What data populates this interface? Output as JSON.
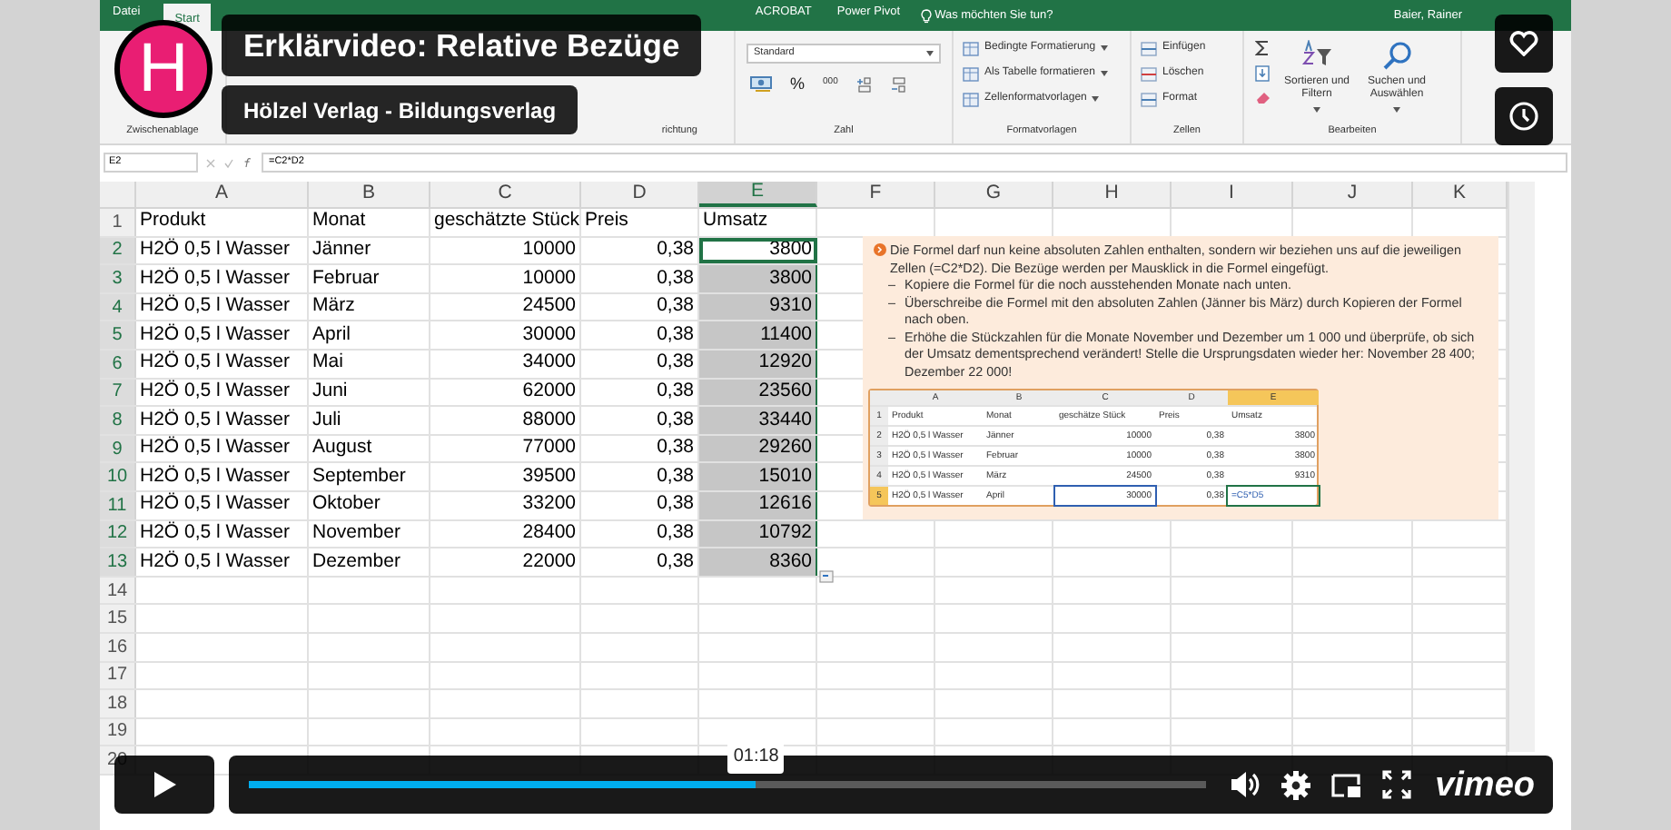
{
  "video": {
    "logo_letter": "H",
    "title": "Erklärvideo: Relative Bezüge",
    "channel": "Hölzel Verlag - Bildungsverlag",
    "progress": {
      "level": 0.53,
      "tooltip": "01:18"
    },
    "brand": "vimeo"
  },
  "excel": {
    "ribbon_tabs": [
      {
        "label": "Datei",
        "selected": false
      },
      {
        "label": "Start",
        "selected": true
      },
      {
        "label": "ACROBAT",
        "selected": false
      },
      {
        "label": "Power Pivot",
        "selected": false
      }
    ],
    "tell_me": "Was möchten Sie tun?",
    "user": "Baier, Rainer",
    "groups": {
      "clipboard": "Zwischenablage",
      "alignment": "richtung",
      "number": "Zahl",
      "styles": "Formatvorlagen",
      "cells": "Zellen",
      "editing": "Bearbeiten"
    },
    "number_format": "Standard",
    "percent": "%",
    "thousands": "000",
    "styles": [
      "Bedingte Formatierung",
      "Als Tabelle formatieren",
      "Zellenformatvorlagen"
    ],
    "cell_commands": [
      "Einfügen",
      "Löschen",
      "Format"
    ],
    "editing_commands": [
      "Sortieren und Filtern",
      "Suchen und Auswählen"
    ],
    "name_box": "E2",
    "formula": "=C2*D2",
    "columns": [
      {
        "label": "A",
        "selected": false
      },
      {
        "label": "B",
        "selected": false
      },
      {
        "label": "C",
        "selected": false
      },
      {
        "label": "D",
        "selected": false
      },
      {
        "label": "E",
        "selected": true
      },
      {
        "label": "F",
        "selected": false
      },
      {
        "label": "G",
        "selected": false
      },
      {
        "label": "H",
        "selected": false
      },
      {
        "label": "I",
        "selected": false
      },
      {
        "label": "J",
        "selected": false
      },
      {
        "label": "K",
        "selected": false
      }
    ],
    "rows": [
      {
        "number": "1",
        "cells": [
          "Produkt",
          "Monat",
          "geschätzte Stück",
          "Preis",
          "Umsatz"
        ],
        "selected": false,
        "active": false
      },
      {
        "number": "2",
        "cells": [
          "H2Ö 0,5 l Wasser",
          "Jänner",
          "10000",
          "0,38",
          "3800"
        ],
        "selected": true,
        "active": true
      },
      {
        "number": "3",
        "cells": [
          "H2Ö 0,5 l Wasser",
          "Februar",
          "10000",
          "0,38",
          "3800"
        ],
        "selected": true,
        "active": false
      },
      {
        "number": "4",
        "cells": [
          "H2Ö 0,5 l Wasser",
          "März",
          "24500",
          "0,38",
          "9310"
        ],
        "selected": true,
        "active": false
      },
      {
        "number": "5",
        "cells": [
          "H2Ö 0,5 l Wasser",
          "April",
          "30000",
          "0,38",
          "11400"
        ],
        "selected": true,
        "active": false
      },
      {
        "number": "6",
        "cells": [
          "H2Ö 0,5 l Wasser",
          "Mai",
          "34000",
          "0,38",
          "12920"
        ],
        "selected": true,
        "active": false
      },
      {
        "number": "7",
        "cells": [
          "H2Ö 0,5 l Wasser",
          "Juni",
          "62000",
          "0,38",
          "23560"
        ],
        "selected": true,
        "active": false
      },
      {
        "number": "8",
        "cells": [
          "H2Ö 0,5 l Wasser",
          "Juli",
          "88000",
          "0,38",
          "33440"
        ],
        "selected": true,
        "active": false
      },
      {
        "number": "9",
        "cells": [
          "H2Ö 0,5 l Wasser",
          "August",
          "77000",
          "0,38",
          "29260"
        ],
        "selected": true,
        "active": false
      },
      {
        "number": "10",
        "cells": [
          "H2Ö 0,5 l Wasser",
          "September",
          "39500",
          "0,38",
          "15010"
        ],
        "selected": true,
        "active": false
      },
      {
        "number": "11",
        "cells": [
          "H2Ö 0,5 l Wasser",
          "Oktober",
          "33200",
          "0,38",
          "12616"
        ],
        "selected": true,
        "active": false
      },
      {
        "number": "12",
        "cells": [
          "H2Ö 0,5 l Wasser",
          "November",
          "28400",
          "0,38",
          "10792"
        ],
        "selected": true,
        "active": false
      },
      {
        "number": "13",
        "cells": [
          "H2Ö 0,5 l Wasser",
          "Dezember",
          "22000",
          "0,38",
          "8360"
        ],
        "selected": true,
        "active": false
      }
    ],
    "empty_rows": [
      "14",
      "15",
      "16",
      "17",
      "18",
      "19",
      "20"
    ],
    "instruction": {
      "intro": "Die Formel darf nun keine absoluten Zahlen enthalten, sondern wir beziehen uns auf die jeweiligen Zellen (=C2*D2). Die Bezüge werden per Mausklick in die Formel eingefügt.",
      "bullets": [
        {
          "marker": "–",
          "text": "Kopiere die Formel für die noch ausstehenden Monate nach unten."
        },
        {
          "marker": "–",
          "text": "Überschreibe die Formel mit den absoluten Zahlen (Jänner bis März) durch Kopieren der Formel nach oben."
        },
        {
          "marker": "–",
          "text": "Erhöhe die Stückzahlen für die Monate November und Dezember um 1 000 und überprüfe, ob sich der Umsatz dementsprechend verändert! Stelle die Ursprungsdaten wieder her: November 28 400; Dezember 22 000!"
        }
      ],
      "mini_table": {
        "columns": [
          {
            "label": "A",
            "selected": false
          },
          {
            "label": "B",
            "selected": false
          },
          {
            "label": "C",
            "selected": false
          },
          {
            "label": "D",
            "selected": false
          },
          {
            "label": "E",
            "selected": true
          }
        ],
        "rows": [
          {
            "number": "1",
            "cells": [
              "Produkt",
              "Monat",
              "geschätze Stück",
              "Preis",
              "Umsatz"
            ],
            "selected": false
          },
          {
            "number": "2",
            "cells": [
              "H2Ö 0,5 l Wasser",
              "Jänner",
              "10000",
              "0,38",
              "3800"
            ],
            "selected": false
          },
          {
            "number": "3",
            "cells": [
              "H2Ö 0,5 l Wasser",
              "Februar",
              "10000",
              "0,38",
              "3800"
            ],
            "selected": false
          },
          {
            "number": "4",
            "cells": [
              "H2Ö 0,5 l Wasser",
              "März",
              "24500",
              "0,38",
              "9310"
            ],
            "selected": false
          },
          {
            "number": "5",
            "cells": [
              "H2Ö 0,5 l Wasser",
              "April",
              "30000",
              "0,38",
              "=C5*D5"
            ],
            "selected": true
          }
        ]
      }
    }
  }
}
